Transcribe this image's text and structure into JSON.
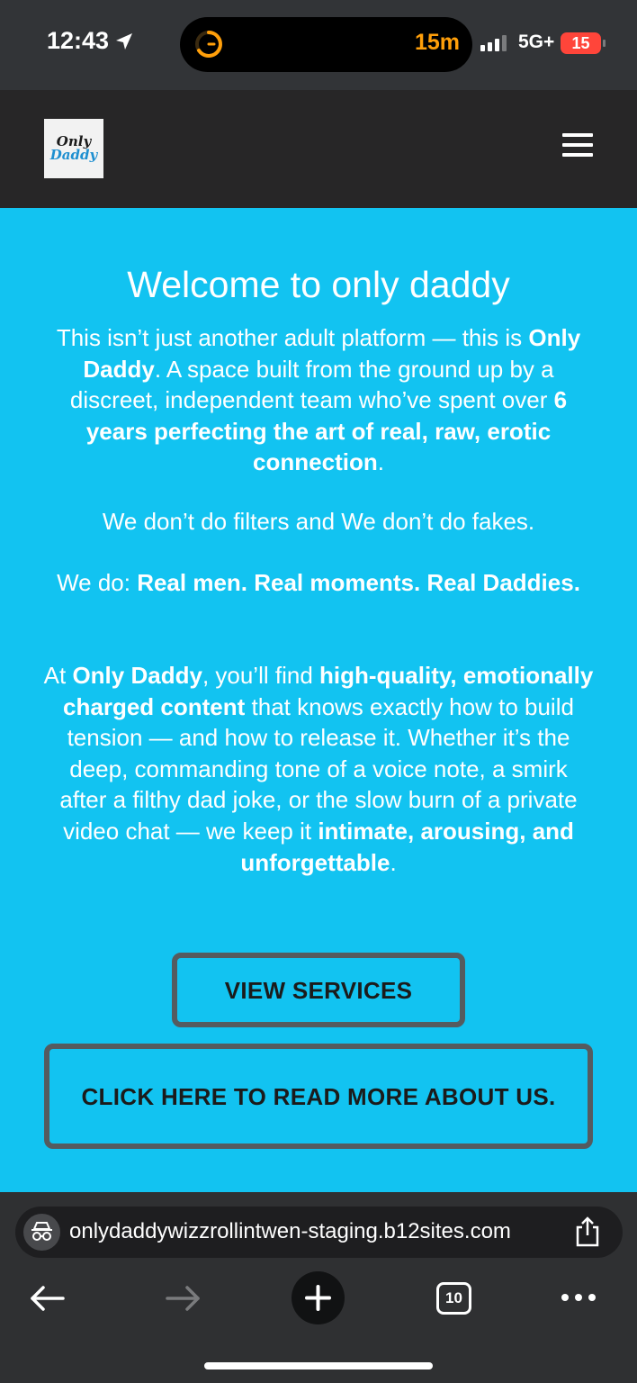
{
  "status_bar": {
    "time": "12:43",
    "timer": "15m",
    "network": "5G+",
    "battery": "15",
    "location_icon": "location-arrow-icon",
    "timer_icon": "timer-ring-icon"
  },
  "header": {
    "logo_line1": "Only",
    "logo_line2": "Daddy",
    "menu_icon": "hamburger-menu-icon"
  },
  "hero": {
    "title": "Welcome to only daddy",
    "p1": {
      "t1": "This isn’t just another adult platform — this is ",
      "b1": "Only Daddy",
      "t2": ". A space built from the ground up by a discreet, independent team who’ve spent over ",
      "b2": "6 years perfecting the art of real, raw, erotic connection",
      "t3": "."
    },
    "p2": "We don’t do filters and We don’t do fakes.",
    "p3": {
      "t1": "We do: ",
      "b1": "Real men. Real moments. Real Daddies."
    },
    "p4": {
      "t1": "At ",
      "b1": "Only Daddy",
      "t2": ", you’ll find ",
      "b2": "high-quality, emotionally charged content",
      "t3": " that knows exactly how to build tension — and how to release it. Whether it’s the deep, commanding tone of a voice note, a smirk after a filthy dad joke, or the slow burn of a private video chat — we keep it ",
      "b3": "intimate, arousing, and unforgettable",
      "t4": "."
    },
    "btn_services": "VIEW SERVICES",
    "btn_about": "CLICK HERE TO READ MORE ABOUT US."
  },
  "browser": {
    "url": "onlydaddywizzrollintwen-staging.b12sites.com",
    "tab_count": "10",
    "icons": [
      "incognito-icon",
      "share-icon",
      "back-arrow-icon",
      "forward-arrow-icon",
      "new-tab-plus-icon",
      "tabs-icon",
      "more-icon"
    ]
  },
  "colors": {
    "hero_bg": "#12c3f1",
    "header_bg": "#272627",
    "button_border": "#555b5f",
    "timer_orange": "#ff9f0a",
    "battery_red": "#ff453a"
  }
}
